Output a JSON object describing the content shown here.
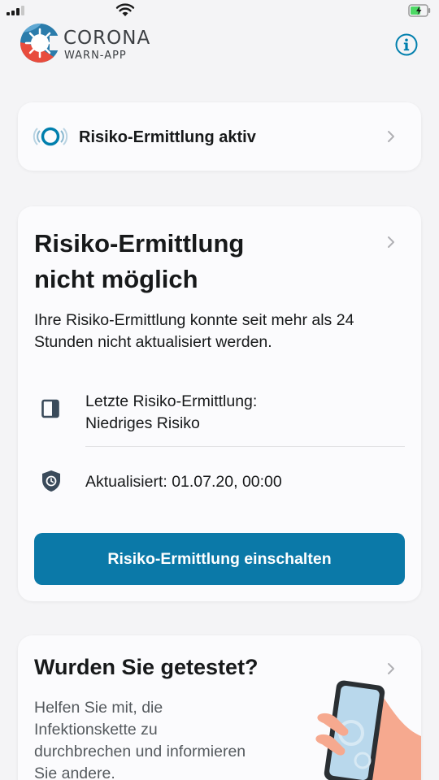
{
  "app": {
    "logo_title": "CORONA",
    "logo_subtitle": "WARN-APP"
  },
  "status_card": {
    "label": "Risiko-Ermittlung aktiv"
  },
  "risk_card": {
    "title_line1": "Risiko-Ermittlung",
    "title_line2": "nicht möglich",
    "body_line1": "Ihre Risiko-Ermittlung konnte seit mehr als 24",
    "body_line2": "Stunden nicht aktualisiert werden.",
    "last_check_label": "Letzte Risiko-Ermittlung:",
    "last_check_value": "Niedriges Risiko",
    "updated_text": "Aktualisiert: 01.07.20, 00:00",
    "button_label": "Risiko-Ermittlung einschalten"
  },
  "test_card": {
    "title": "Wurden Sie getestet?",
    "body_line1": "Helfen Sie mit, die",
    "body_line2": "Infektionskette zu",
    "body_line3": "durchbrechen und informieren",
    "body_line4": "Sie andere."
  },
  "colors": {
    "primary": "#0b79a8",
    "accent": "#007fad",
    "background": "#f4f4f6",
    "card": "#fbfbfd"
  },
  "icons": {
    "info": "info-circle-icon",
    "status": "pulse-ring-icon",
    "last_check": "risk-square-icon",
    "updated": "shield-clock-icon"
  }
}
